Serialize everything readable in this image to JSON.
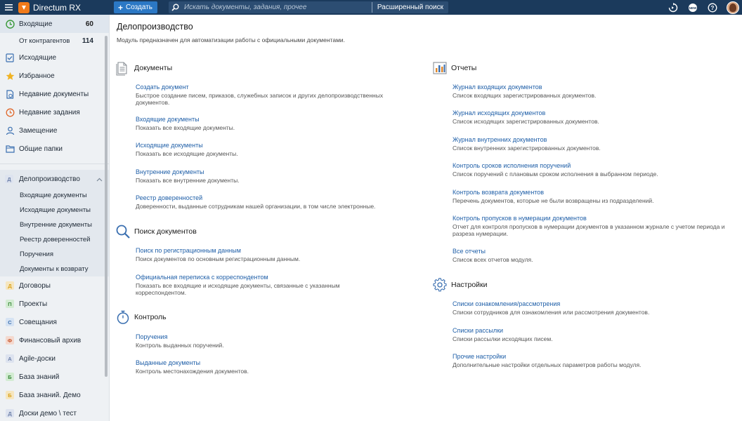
{
  "topbar": {
    "app_title": "Directum RX",
    "create_label": "Создать",
    "search_placeholder": "Искать документы, задания, прочее",
    "advanced_search": "Расширенный поиск",
    "brand_color": "#1b3a5c",
    "accent_color": "#2b78c5"
  },
  "sidebar": {
    "items": [
      {
        "label": "Входящие",
        "count": "60",
        "icon": "inbox-clock-icon"
      },
      {
        "label": "От контрагентов",
        "count": "114"
      },
      {
        "label": "Исходящие",
        "icon": "outbox-check-icon"
      },
      {
        "label": "Избранное",
        "icon": "star-icon"
      },
      {
        "label": "Недавние документы",
        "icon": "recent-document-icon"
      },
      {
        "label": "Недавние задания",
        "icon": "recent-task-icon"
      },
      {
        "label": "Замещение",
        "icon": "substitution-user-icon"
      },
      {
        "label": "Общие папки",
        "icon": "shared-folder-icon"
      }
    ],
    "group": {
      "letter": "Д",
      "label": "Делопроизводство",
      "children": [
        "Входящие документы",
        "Исходящие документы",
        "Внутренние документы",
        "Реестр доверенностей",
        "Поручения",
        "Документы к возврату"
      ]
    },
    "modules": [
      {
        "letter": "Д",
        "label": "Договоры",
        "color": "#d9a21b",
        "bg": "#f6e6bf"
      },
      {
        "letter": "П",
        "label": "Проекты",
        "color": "#3a8a3a",
        "bg": "#d3ecd3"
      },
      {
        "letter": "С",
        "label": "Совещания",
        "color": "#3a6fb0",
        "bg": "#d6e3f3"
      },
      {
        "letter": "Ф",
        "label": "Финансовый архив",
        "color": "#c7552b",
        "bg": "#f4d9cf"
      },
      {
        "letter": "А",
        "label": "Agile-доски",
        "color": "#6b7fa8",
        "bg": "#dde3ef"
      },
      {
        "letter": "Б",
        "label": "База знаний",
        "color": "#3a8a3a",
        "bg": "#d3ecd3"
      },
      {
        "letter": "Б",
        "label": "База знаний. Демо",
        "color": "#d9a21b",
        "bg": "#f6e6bf"
      },
      {
        "letter": "Д",
        "label": "Доски демо \\ тест",
        "color": "#6b7fa8",
        "bg": "#dde3ef"
      }
    ]
  },
  "main": {
    "title": "Делопроизводство",
    "subtitle": "Модуль предназначен для автоматизации работы с официальными документами.",
    "sections": {
      "documents": {
        "title": "Документы",
        "links": [
          {
            "label": "Создать документ",
            "desc": "Быстрое создание писем, приказов, служебных записок и других делопроизводственных документов."
          },
          {
            "label": "Входящие документы",
            "desc": "Показать все входящие документы."
          },
          {
            "label": "Исходящие документы",
            "desc": "Показать все исходящие документы."
          },
          {
            "label": "Внутренние документы",
            "desc": "Показать все внутренние документы."
          },
          {
            "label": "Реестр доверенностей",
            "desc": "Доверенности, выданные сотрудникам нашей организации, в том числе электронные."
          }
        ]
      },
      "search": {
        "title": "Поиск документов",
        "links": [
          {
            "label": "Поиск по регистрационным данным",
            "desc": "Поиск документов по основным регистрационным данным."
          },
          {
            "label": "Официальная переписка с корреспондентом",
            "desc": "Показать все входящие и исходящие документы, связанные с указанным корреспондентом."
          }
        ]
      },
      "control": {
        "title": "Контроль",
        "links": [
          {
            "label": "Поручения",
            "desc": "Контроль выданных поручений."
          },
          {
            "label": "Выданные документы",
            "desc": "Контроль местонахождения документов."
          }
        ]
      },
      "reports": {
        "title": "Отчеты",
        "links": [
          {
            "label": "Журнал входящих документов",
            "desc": "Список входящих зарегистрированных документов."
          },
          {
            "label": "Журнал исходящих документов",
            "desc": "Список исходящих зарегистрированных документов."
          },
          {
            "label": "Журнал внутренних документов",
            "desc": "Список внутренних зарегистрированных документов."
          },
          {
            "label": "Контроль сроков исполнения поручений",
            "desc": "Список поручений с плановым сроком исполнения в выбранном периоде."
          },
          {
            "label": "Контроль возврата документов",
            "desc": "Перечень документов, которые не были возвращены из подразделений."
          },
          {
            "label": "Контроль пропусков в нумерации документов",
            "desc": "Отчет для контроля пропусков в нумерации документов в указанном журнале с учетом периода и разреза нумерации."
          },
          {
            "label": "Все отчеты",
            "desc": "Список всех отчетов модуля."
          }
        ]
      },
      "settings": {
        "title": "Настройки",
        "links": [
          {
            "label": "Списки ознакомления/рассмотрения",
            "desc": "Списки сотрудников для ознакомления или рассмотрения документов."
          },
          {
            "label": "Списки рассылки",
            "desc": "Списки рассылки исходящих писем."
          },
          {
            "label": "Прочие настройки",
            "desc": "Дополнительные настройки отдельных параметров работы модуля."
          }
        ]
      }
    }
  }
}
